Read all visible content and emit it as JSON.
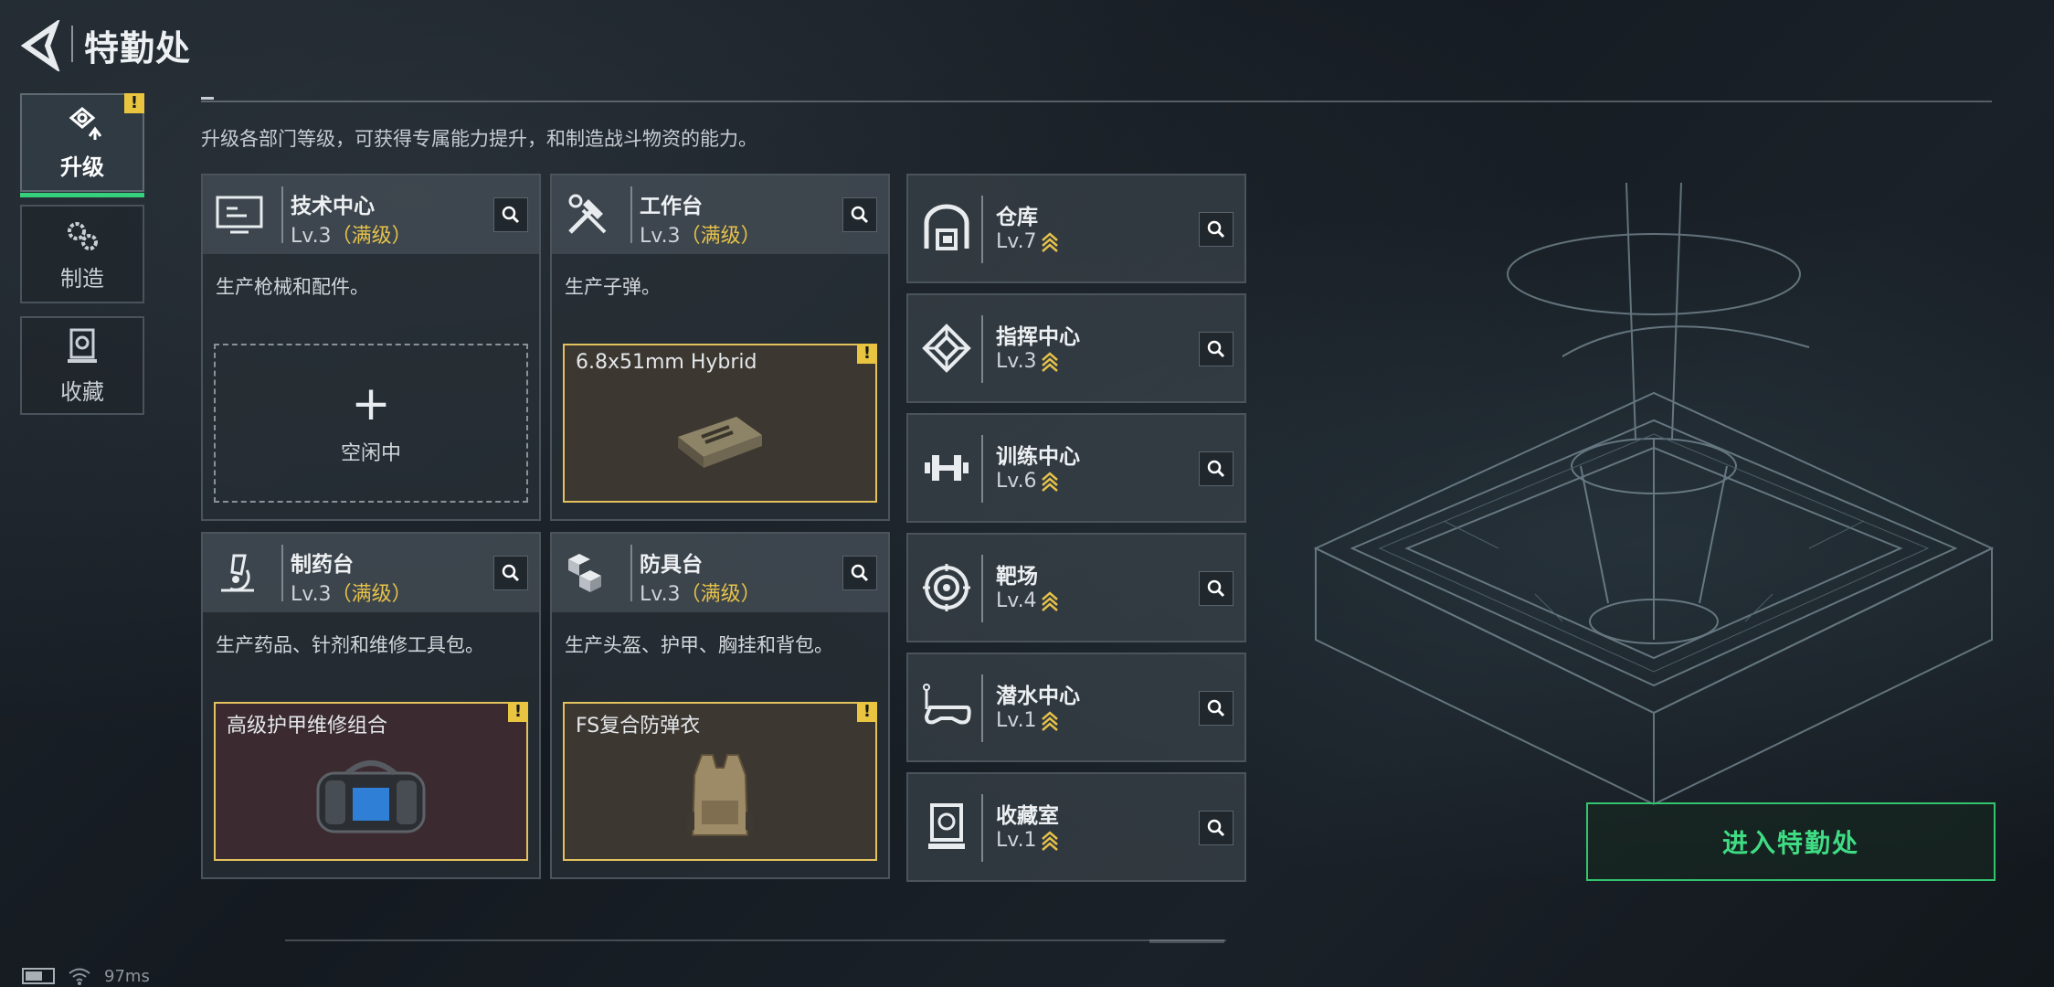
{
  "header": {
    "title": "特勤处"
  },
  "nav": [
    {
      "label": "升级",
      "icon": "upgrade-icon",
      "active": true,
      "alert": true
    },
    {
      "label": "制造",
      "icon": "gears-icon",
      "active": false,
      "alert": false
    },
    {
      "label": "收藏",
      "icon": "collection-icon",
      "active": false,
      "alert": false
    }
  ],
  "intro": "升级各部门等级，可获得专属能力提升，和制造战斗物资的能力。",
  "facilities": [
    {
      "name": "技术中心",
      "level": "Lv.3",
      "max": "（满级）",
      "icon": "monitor-icon",
      "desc": "生产枪械和配件。",
      "slot": {
        "type": "empty",
        "plus": "+",
        "label": "空闲中"
      }
    },
    {
      "name": "工作台",
      "level": "Lv.3",
      "max": "（满级）",
      "icon": "tools-icon",
      "desc": "生产子弹。",
      "slot": {
        "type": "item",
        "name": "6.8x51mm Hybrid",
        "alert": "!",
        "color": "brown",
        "art": "ammo-box-image"
      }
    },
    {
      "name": "制药台",
      "level": "Lv.3",
      "max": "（满级）",
      "icon": "microscope-icon",
      "desc": "生产药品、针剂和维修工具包。",
      "slot": {
        "type": "item",
        "name": "高级护甲维修组合",
        "alert": "!",
        "color": "red",
        "art": "repair-kit-image"
      }
    },
    {
      "name": "防具台",
      "level": "Lv.3",
      "max": "（满级）",
      "icon": "cubes-icon",
      "desc": "生产头盔、护甲、胸挂和背包。",
      "slot": {
        "type": "item",
        "name": "FS复合防弹衣",
        "alert": "!",
        "color": "brown",
        "art": "vest-image"
      }
    }
  ],
  "rooms": [
    {
      "name": "仓库",
      "level": "Lv.7",
      "icon": "warehouse-icon"
    },
    {
      "name": "指挥中心",
      "level": "Lv.3",
      "icon": "command-icon"
    },
    {
      "name": "训练中心",
      "level": "Lv.6",
      "icon": "dumbbell-icon"
    },
    {
      "name": "靶场",
      "level": "Lv.4",
      "icon": "target-icon"
    },
    {
      "name": "潜水中心",
      "level": "Lv.1",
      "icon": "dive-mask-icon"
    },
    {
      "name": "收藏室",
      "level": "Lv.1",
      "icon": "collection-room-icon"
    }
  ],
  "enter_button": "进入特勤处",
  "status": {
    "ping": "97ms"
  },
  "colors": {
    "accent_green": "#35d07b",
    "max_gold": "#e6c24a",
    "alert_yellow": "#e8c440"
  }
}
